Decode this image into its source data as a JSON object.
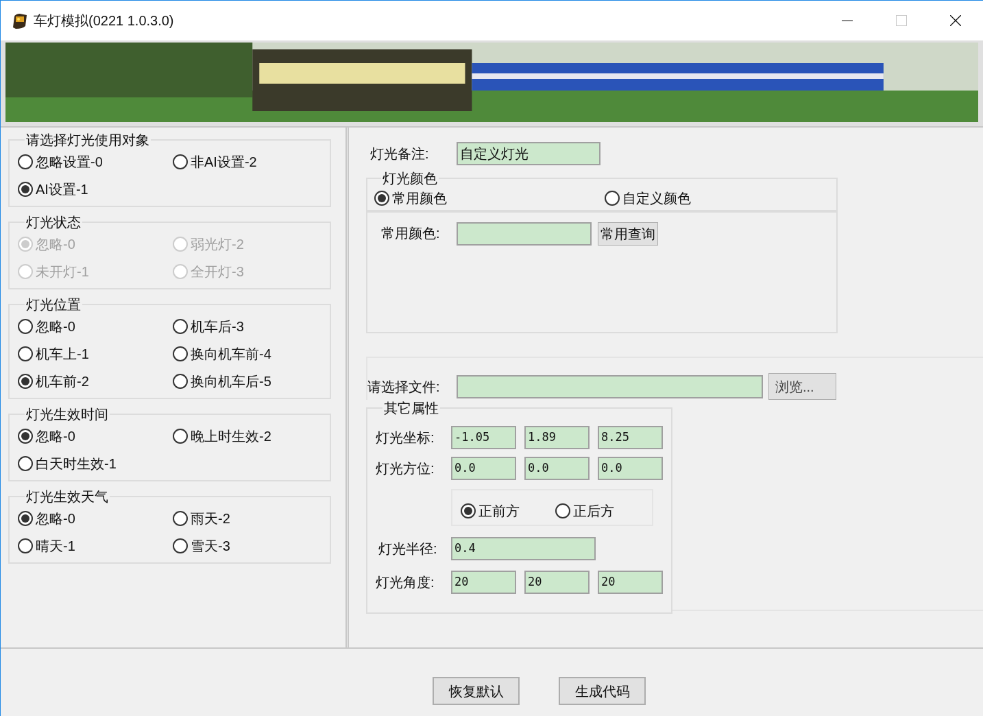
{
  "window": {
    "title": "车灯模拟(0221 1.0.3.0)"
  },
  "left_groups": [
    {
      "title": "请选择灯光使用对象",
      "disabled": false,
      "options": [
        {
          "label": "忽略设置-0",
          "selected": false
        },
        {
          "label": "非AI设置-2",
          "selected": false
        },
        {
          "label": "AI设置-1",
          "selected": true
        }
      ]
    },
    {
      "title": "灯光状态",
      "disabled": true,
      "options": [
        {
          "label": "忽略-0",
          "selected": true
        },
        {
          "label": "弱光灯-2",
          "selected": false
        },
        {
          "label": "未开灯-1",
          "selected": false
        },
        {
          "label": "全开灯-3",
          "selected": false
        }
      ]
    },
    {
      "title": "灯光位置",
      "disabled": false,
      "options": [
        {
          "label": "忽略-0",
          "selected": false
        },
        {
          "label": "机车后-3",
          "selected": false
        },
        {
          "label": "机车上-1",
          "selected": false
        },
        {
          "label": "换向机车前-4",
          "selected": false
        },
        {
          "label": "机车前-2",
          "selected": true
        },
        {
          "label": "换向机车后-5",
          "selected": false
        }
      ]
    },
    {
      "title": "灯光生效时间",
      "disabled": false,
      "options": [
        {
          "label": "忽略-0",
          "selected": true
        },
        {
          "label": "晚上时生效-2",
          "selected": false
        },
        {
          "label": "白天时生效-1",
          "selected": false
        }
      ]
    },
    {
      "title": "灯光生效天气",
      "disabled": false,
      "options": [
        {
          "label": "忽略-0",
          "selected": true
        },
        {
          "label": "雨天-2",
          "selected": false
        },
        {
          "label": "晴天-1",
          "selected": false
        },
        {
          "label": "雪天-3",
          "selected": false
        }
      ]
    }
  ],
  "note": {
    "label": "灯光备注:",
    "value": "自定义灯光"
  },
  "light_color": {
    "title": "灯光颜色",
    "options": [
      {
        "label": "常用颜色",
        "selected": true
      },
      {
        "label": "自定义颜色",
        "selected": false
      }
    ],
    "common_label": "常用颜色:",
    "query_button": "常用查询"
  },
  "file": {
    "label": "请选择文件:",
    "browse_button": "浏览..."
  },
  "other_properties": {
    "title": "其它属性",
    "coordinates": {
      "label": "灯光坐标:",
      "values": [
        "-1.05",
        "1.89",
        "8.25"
      ]
    },
    "orientation": {
      "label": "灯光方位:",
      "values": [
        "0.0",
        "0.0",
        "0.0"
      ]
    },
    "direction": [
      {
        "label": "正前方",
        "selected": true
      },
      {
        "label": "正后方",
        "selected": false
      }
    ],
    "radius": {
      "label": "灯光半径:",
      "value": "0.4"
    },
    "angle": {
      "label": "灯光角度:",
      "values": [
        "20",
        "20",
        "20"
      ]
    }
  },
  "buttons": [
    "恢复默认",
    "生成代码"
  ]
}
